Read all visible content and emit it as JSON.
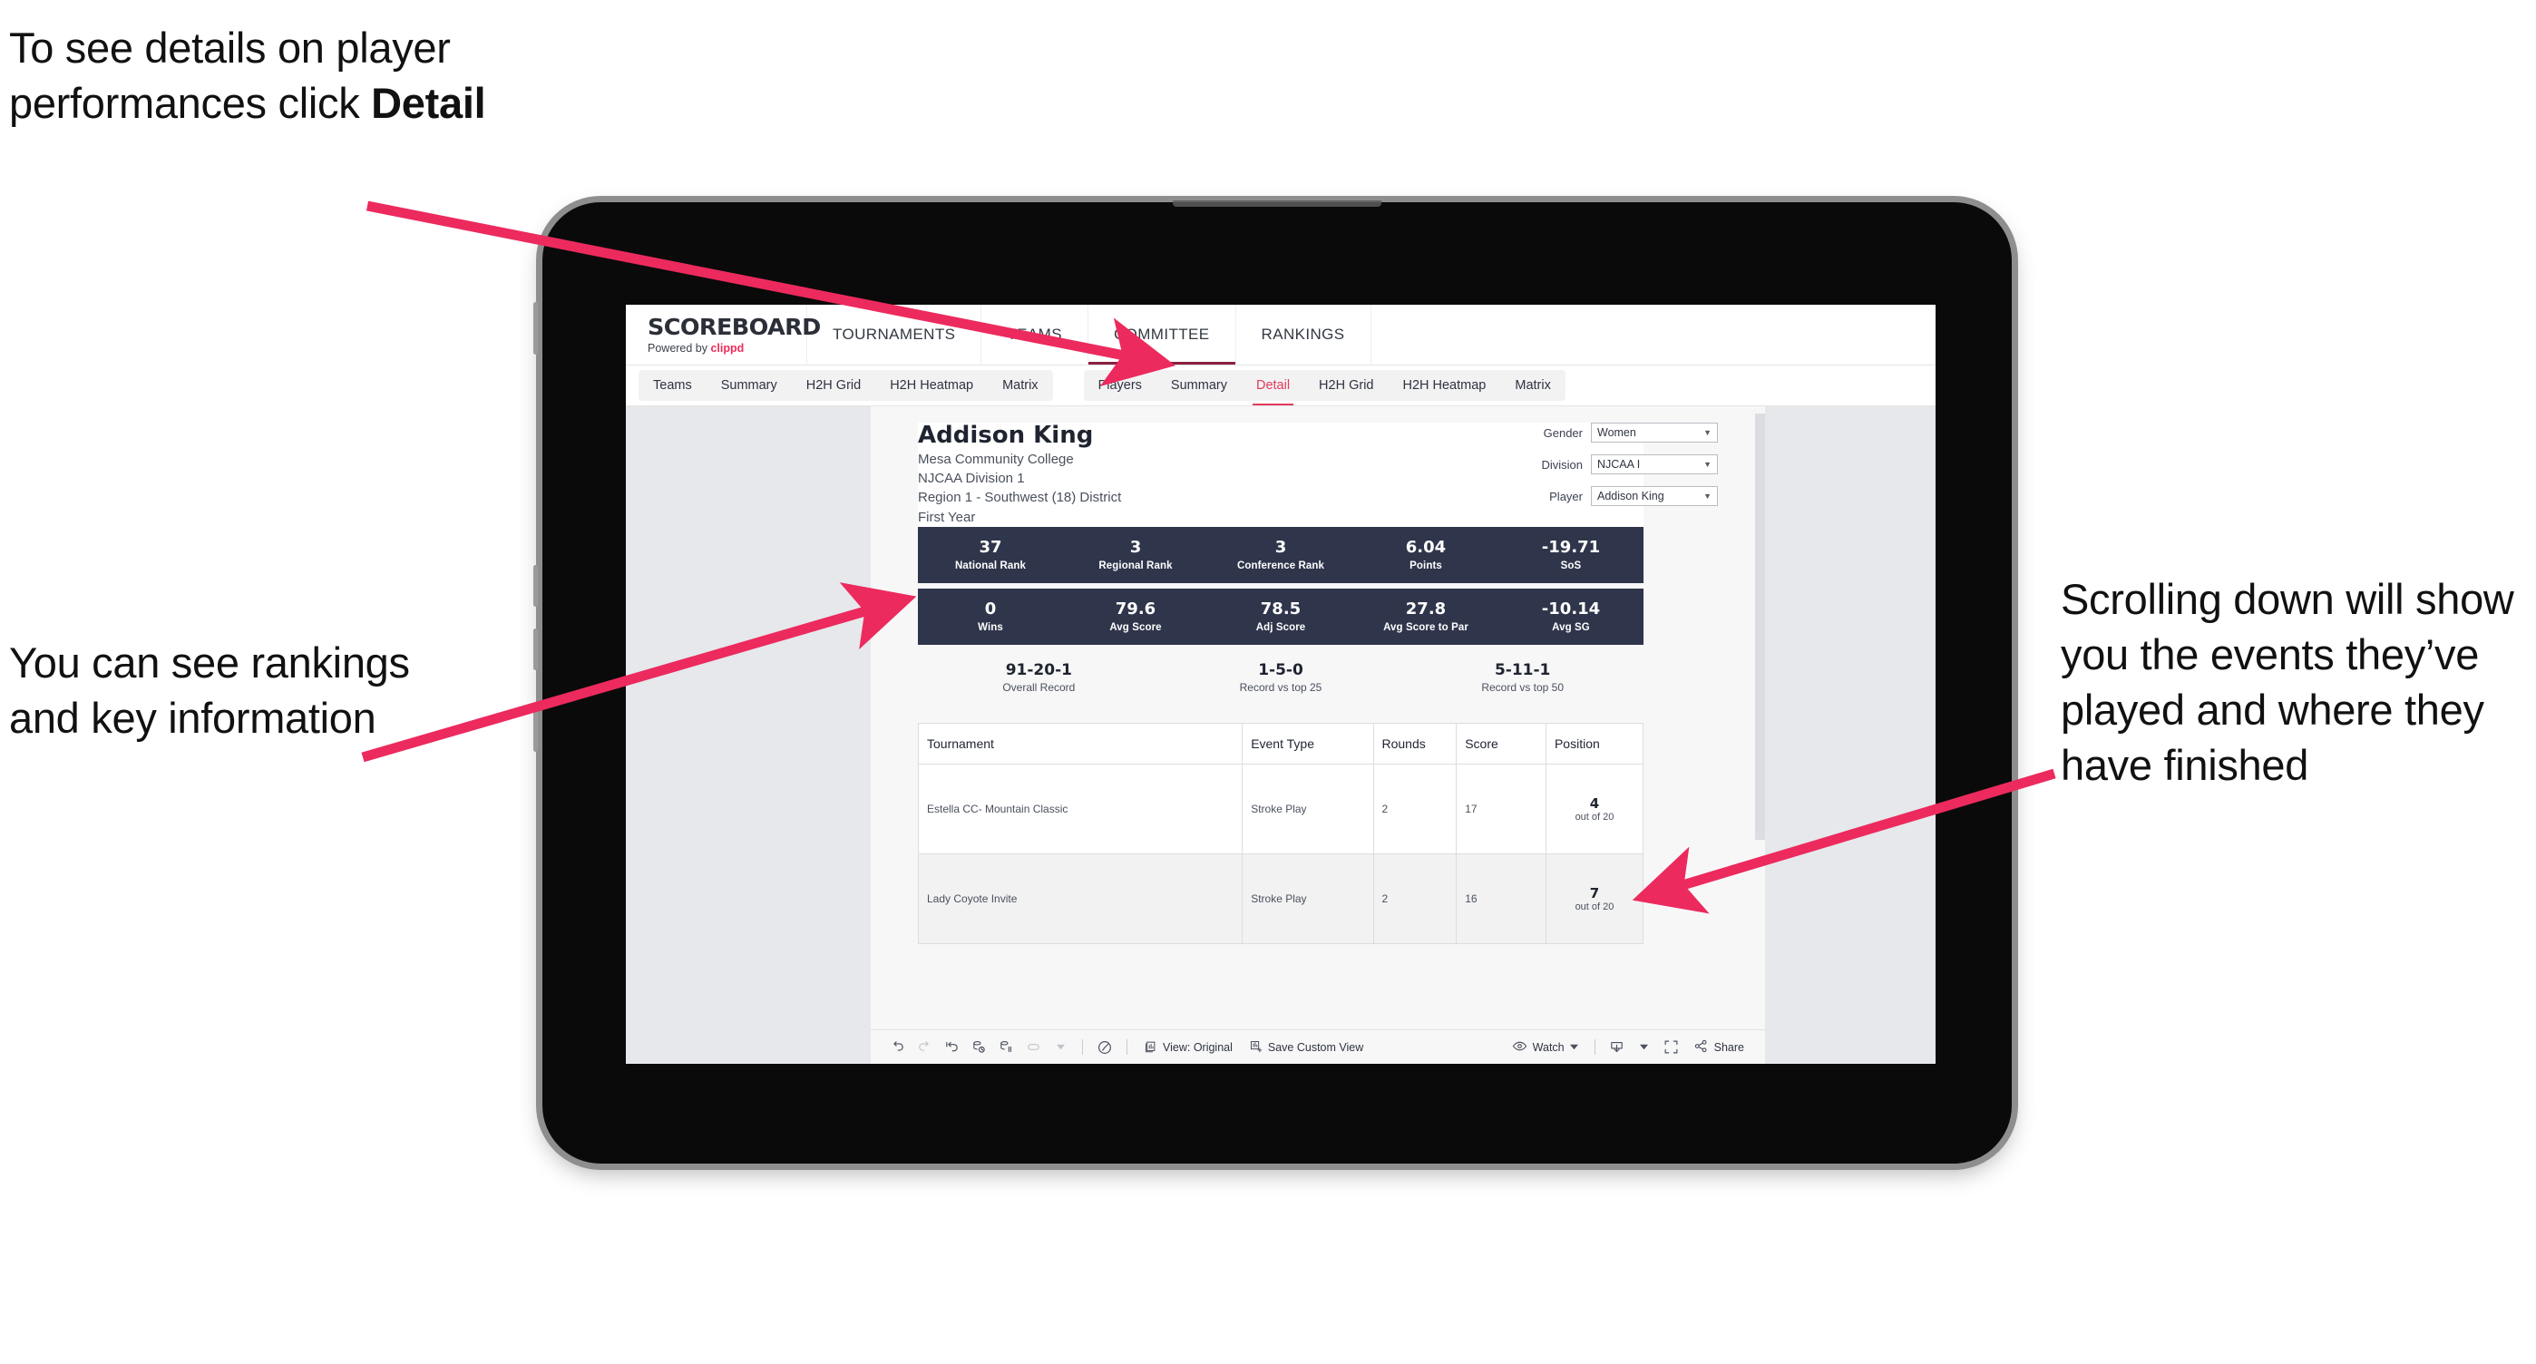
{
  "annotations": {
    "detail": {
      "text_plain": "To see details on player performances click ",
      "text_bold": "Detail"
    },
    "rankings": {
      "text": "You can see rankings and key information"
    },
    "scroll": {
      "text": "Scrolling down will show you the events they’ve played and where they have finished"
    }
  },
  "colors": {
    "accent_pink": "#ee2b5b",
    "arrow_pink": "#ec2a5e",
    "stat_bar_navy": "#2f364b",
    "active_tab_red": "#e23b5a"
  },
  "app": {
    "brand": {
      "title": "SCOREBOARD",
      "powered_prefix": "Powered by ",
      "powered_name": "clippd"
    },
    "top_nav": [
      {
        "label": "TOURNAMENTS",
        "active": false
      },
      {
        "label": "TEAMS",
        "active": false
      },
      {
        "label": "COMMITTEE",
        "active": true
      },
      {
        "label": "RANKINGS",
        "active": false
      }
    ],
    "sub_nav": {
      "group_teams": [
        "Teams",
        "Summary",
        "H2H Grid",
        "H2H Heatmap",
        "Matrix"
      ],
      "group_players": [
        "Players",
        "Summary",
        "Detail",
        "H2H Grid",
        "H2H Heatmap",
        "Matrix"
      ],
      "active_tab": "Detail"
    }
  },
  "player": {
    "name": "Addison King",
    "school": "Mesa Community College",
    "division": "NJCAA Division 1",
    "region": "Region 1 - Southwest (18) District",
    "year": "First Year"
  },
  "filters": [
    {
      "label": "Gender",
      "value": "Women"
    },
    {
      "label": "Division",
      "value": "NJCAA I"
    },
    {
      "label": "Player",
      "value": "Addison King"
    }
  ],
  "stats_row_1": [
    {
      "value": "37",
      "label": "National Rank"
    },
    {
      "value": "3",
      "label": "Regional Rank"
    },
    {
      "value": "3",
      "label": "Conference Rank"
    },
    {
      "value": "6.04",
      "label": "Points"
    },
    {
      "value": "-19.71",
      "label": "SoS"
    }
  ],
  "stats_row_2": [
    {
      "value": "0",
      "label": "Wins"
    },
    {
      "value": "79.6",
      "label": "Avg Score"
    },
    {
      "value": "78.5",
      "label": "Adj Score"
    },
    {
      "value": "27.8",
      "label": "Avg Score to Par"
    },
    {
      "value": "-10.14",
      "label": "Avg SG"
    }
  ],
  "records": [
    {
      "value": "91-20-1",
      "label": "Overall Record"
    },
    {
      "value": "1-5-0",
      "label": "Record vs top 25"
    },
    {
      "value": "5-11-1",
      "label": "Record vs top 50"
    }
  ],
  "table": {
    "headers": [
      "Tournament",
      "Event Type",
      "Rounds",
      "Score",
      "Position"
    ],
    "rows": [
      {
        "tournament": "Estella CC- Mountain Classic",
        "event_type": "Stroke Play",
        "rounds": "2",
        "score": "17",
        "position": "4",
        "position_of": "out of 20"
      },
      {
        "tournament": "Lady Coyote Invite",
        "event_type": "Stroke Play",
        "rounds": "2",
        "score": "16",
        "position": "7",
        "position_of": "out of 20"
      }
    ]
  },
  "toolbar": {
    "view_label": "View: Original",
    "save_label": "Save Custom View",
    "watch_label": "Watch",
    "share_label": "Share"
  }
}
